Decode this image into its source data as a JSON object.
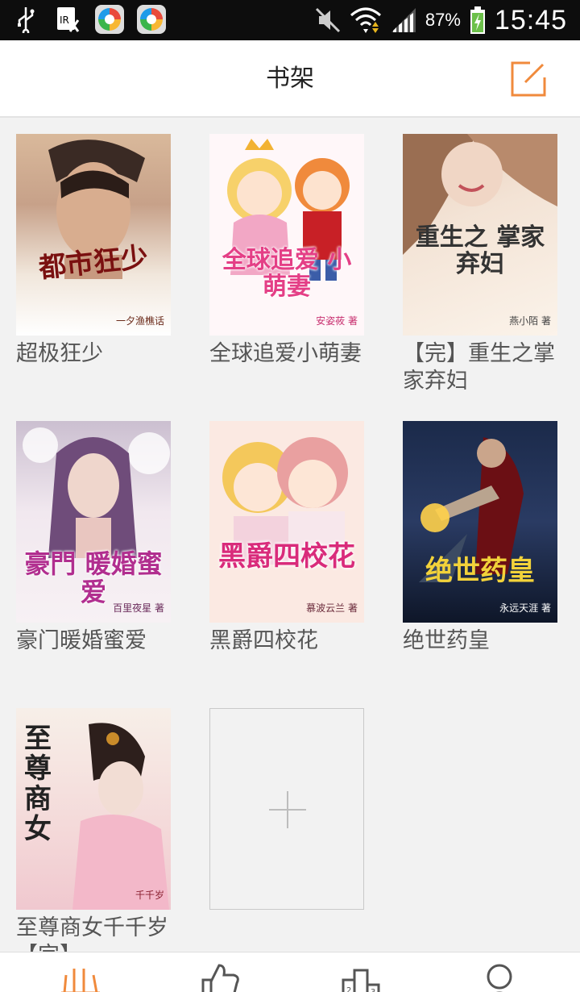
{
  "status_bar": {
    "battery": "87%",
    "time": "15:45",
    "icons": [
      "usb-icon",
      "sim-icon",
      "app-icon",
      "app-icon",
      "mute-icon",
      "wifi-icon",
      "signal-icon",
      "battery-icon"
    ]
  },
  "header": {
    "title": "书架",
    "edit_icon": "edit-icon",
    "accent": "#f08a3c"
  },
  "books": [
    {
      "title": "超极狂少",
      "cover_text": "都市狂少",
      "cover_author": "一夕渔樵话"
    },
    {
      "title": "全球追爱小萌妻",
      "cover_text": "全球追爱 小萌妻",
      "cover_author": "安姿莜 著"
    },
    {
      "title": "【完】重生之掌家弃妇",
      "cover_text": "重生之 掌家弃妇",
      "cover_author": "燕小陌 著"
    },
    {
      "title": "豪门暖婚蜜爱",
      "cover_text": "豪門 暖婚蜜爱",
      "cover_author": "百里夜星 著"
    },
    {
      "title": "黑爵四校花",
      "cover_text": "黑爵四校花",
      "cover_author": "慕波云兰 著"
    },
    {
      "title": "绝世药皇",
      "cover_text": "绝世药皇",
      "cover_author": "永远天涯 著"
    },
    {
      "title": "至尊商女千千岁【完】",
      "cover_text": "至尊 商女",
      "cover_author": "千千岁"
    }
  ],
  "add_tile_icon": "plus-icon",
  "bottom_nav": [
    {
      "name": "bookshelf-icon",
      "active": true
    },
    {
      "name": "thumbs-up-icon",
      "active": false
    },
    {
      "name": "ranking-icon",
      "active": false
    },
    {
      "name": "user-icon",
      "active": false
    }
  ]
}
